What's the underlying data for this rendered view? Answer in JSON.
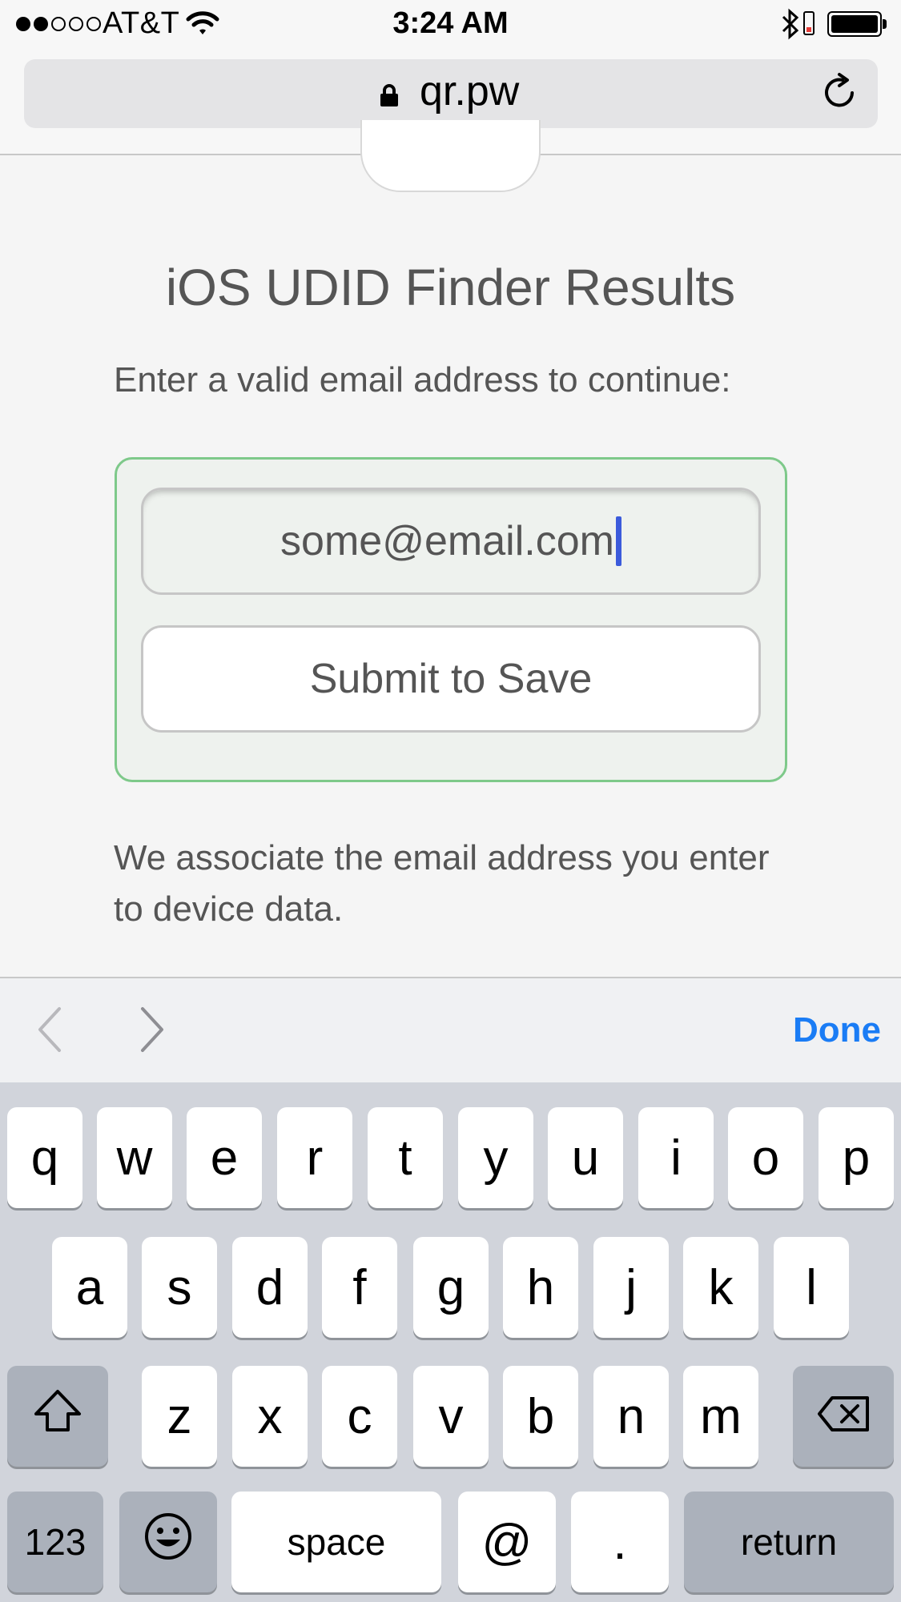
{
  "status_bar": {
    "carrier": "AT&T",
    "time": "3:24 AM",
    "signal_bars_filled": 2,
    "signal_bars_total": 5
  },
  "browser": {
    "url": "qr.pw",
    "icons": {
      "lock": "lock-icon",
      "reload": "reload-icon"
    }
  },
  "page": {
    "title": "iOS UDID Finder Results",
    "instruction": "Enter a valid email address to continue:",
    "email_value": "some@email.com",
    "submit_label": "Submit to Save",
    "note": "We associate the email address you enter to device data.",
    "form_border_color": "#7ec98a"
  },
  "accessory_bar": {
    "done_label": "Done",
    "done_color": "#1a7cf5",
    "icons": {
      "previous": "chevron-left-icon",
      "next": "chevron-right-icon"
    }
  },
  "keyboard": {
    "row1": [
      "q",
      "w",
      "e",
      "r",
      "t",
      "y",
      "u",
      "i",
      "o",
      "p"
    ],
    "row2": [
      "a",
      "s",
      "d",
      "f",
      "g",
      "h",
      "j",
      "k",
      "l"
    ],
    "row3": [
      "z",
      "x",
      "c",
      "v",
      "b",
      "n",
      "m"
    ],
    "numbers_label": "123",
    "space_label": "space",
    "at_label": "@",
    "dot_label": ".",
    "return_label": "return",
    "icons": {
      "shift": "shift-icon",
      "delete": "delete-icon",
      "emoji": "emoji-icon"
    }
  }
}
